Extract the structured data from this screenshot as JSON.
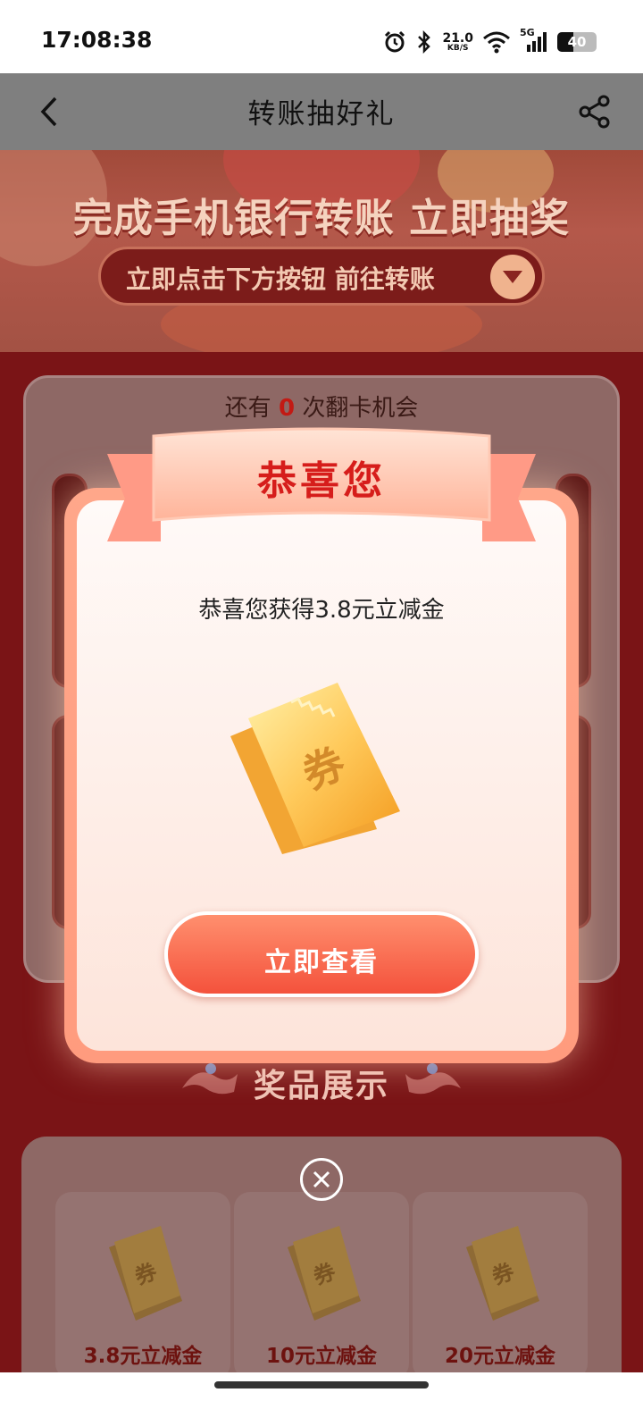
{
  "status_bar": {
    "time": "17:08:38",
    "net_speed": "21.0",
    "net_speed_unit": "KB/S",
    "network_type": "5G",
    "battery": "40",
    "battery_level": 0.4,
    "icons": [
      "alarm-icon",
      "bluetooth-icon",
      "wifi-icon",
      "signal-icon",
      "battery-icon"
    ]
  },
  "nav": {
    "title": "转账抽好礼",
    "back_icon": "chevron-left-icon",
    "share_icon": "share-icon"
  },
  "banner": {
    "headline": "完成手机银行转账 立即抽奖",
    "pill_text": "立即点击下方按钮 前往转账",
    "pill_icon": "chevron-down-icon"
  },
  "game": {
    "chances_prefix": "还有",
    "chances_count": "0",
    "chances_suffix": "次翻卡机会"
  },
  "prize_section": {
    "title": "奖品展示",
    "items": [
      {
        "label": "3.8元立减金"
      },
      {
        "label": "10元立减金"
      },
      {
        "label": "20元立减金"
      }
    ]
  },
  "modal": {
    "ribbon_title": "恭喜您",
    "message": "恭喜您获得3.8元立减金",
    "coupon_char": "券",
    "button_label": "立即查看",
    "close_icon": "close-icon"
  },
  "colors": {
    "page_bg": "#7a1416",
    "accent_red": "#d61d1b",
    "button_gradient_top": "#ff8f6e",
    "button_gradient_bottom": "#f4523c"
  }
}
